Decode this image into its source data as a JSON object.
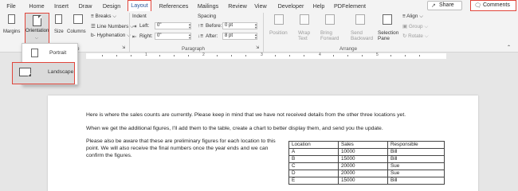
{
  "tabs": [
    "File",
    "Home",
    "Insert",
    "Draw",
    "Design",
    "Layout",
    "References",
    "Mailings",
    "Review",
    "View",
    "Developer",
    "Help",
    "PDFelement"
  ],
  "share_label": "Share",
  "comments_label": "Comments",
  "ribbon": {
    "margins": "Margins",
    "orientation": "Orientation",
    "size": "Size",
    "columns": "Columns",
    "breaks": "Breaks",
    "line_numbers": "Line Numbers",
    "hyphenation": "Hyphenation",
    "page_setup_group": "p",
    "indent_heading": "Indent",
    "left_label": "Left:",
    "left_value": "0\"",
    "right_label": "Right:",
    "right_value": "0\"",
    "spacing_heading": "Spacing",
    "before_label": "Before:",
    "before_value": "0 pt",
    "after_label": "After:",
    "after_value": "8 pt",
    "paragraph_group": "Paragraph",
    "position": "Position",
    "wrap_text": "Wrap Text",
    "bring_forward": "Bring Forward",
    "send_backward": "Send Backward",
    "selection_pane": "Selection Pane",
    "align": "Align",
    "group": "Group",
    "rotate": "Rotate",
    "arrange_group": "Arrange"
  },
  "orientation_menu": {
    "portrait": "Portrait",
    "landscape": "Landscape"
  },
  "document": {
    "para1": "Here is where the sales counts are currently. Please keep in mind that we have not received details from the other three locations yet.",
    "para2": "When we get the additional figures, I'll add them to the table, create a chart to better display them, and send you the update.",
    "para3": "Please also be aware that these are preliminary figures for each location to this point. We will also receive the final numbers once the year ends and we can confirm the figures."
  },
  "table": {
    "headers": [
      "Location",
      "Sales",
      "Responsible"
    ],
    "rows": [
      [
        "A",
        "10000",
        "Bill"
      ],
      [
        "B",
        "15000",
        "Bill"
      ],
      [
        "C",
        "20000",
        "Sue"
      ],
      [
        "D",
        "20000",
        "Sue"
      ],
      [
        "E",
        "15000",
        "Bill"
      ]
    ]
  },
  "ruler_numbers": [
    "1",
    "1",
    "2",
    "3",
    "4",
    "5"
  ],
  "colors": {
    "highlight": "#e0453b",
    "accent": "#2b579a"
  }
}
